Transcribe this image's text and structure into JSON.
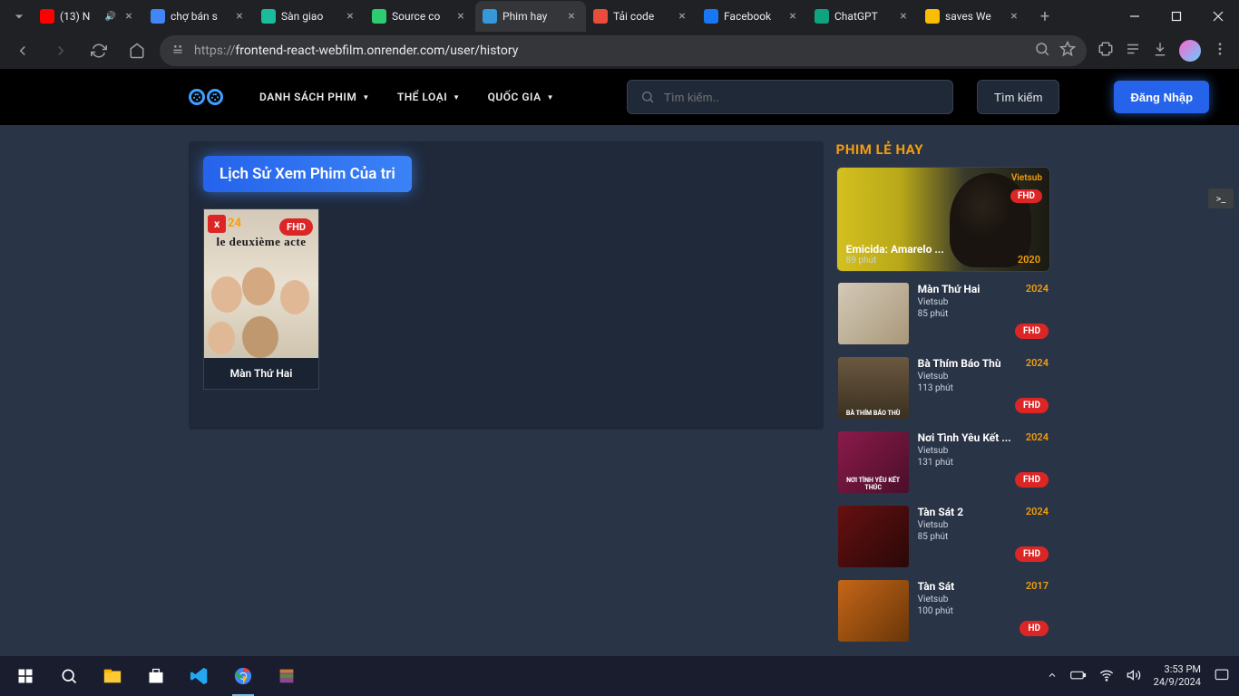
{
  "browser": {
    "tabs": [
      {
        "icon_bg": "#ff0000",
        "title": "(13) N",
        "audio": true
      },
      {
        "icon_bg": "#4285f4",
        "title": "chợ bán s"
      },
      {
        "icon_bg": "#1abc9c",
        "title": "Sàn giao"
      },
      {
        "icon_bg": "#2ecc71",
        "title": "Source co"
      },
      {
        "icon_bg": "#3498db",
        "title": "Phim hay",
        "active": true
      },
      {
        "icon_bg": "#e74c3c",
        "title": "Tải code"
      },
      {
        "icon_bg": "#1877f2",
        "title": "Facebook"
      },
      {
        "icon_bg": "#10a37f",
        "title": "ChatGPT"
      },
      {
        "icon_bg": "#fbbc04",
        "title": "saves We"
      }
    ],
    "url_scheme": "https://",
    "url_rest": "frontend-react-webfilm.onrender.com/user/history"
  },
  "nav": {
    "items": [
      "DANH SÁCH PHIM",
      "THỂ LOẠI",
      "QUỐC GIA"
    ],
    "search_placeholder": "Tìm kiếm..",
    "search_btn": "Tìm kiếm",
    "login_btn": "Đăng Nhập"
  },
  "main": {
    "history_title": "Lịch Sử Xem Phim Của tri",
    "card": {
      "remove": "x",
      "year": "24",
      "quality": "FHD",
      "poster_title": "le deuxième acte",
      "name": "Màn Thứ Hai"
    }
  },
  "sidebar": {
    "title": "PHIM LẺ HAY",
    "featured": {
      "sub": "Vietsub",
      "quality": "FHD",
      "title": "Emicida: Amarelo ...",
      "duration": "89 phút",
      "year": "2020"
    },
    "items": [
      {
        "title": "Màn Thứ Hai",
        "year": "2024",
        "sub": "Vietsub",
        "dur": "85 phút",
        "quality": "FHD",
        "thumb": "thumb-collage",
        "thumb_label": ""
      },
      {
        "title": "Bà Thím Báo Thù",
        "year": "2024",
        "sub": "Vietsub",
        "dur": "113 phút",
        "quality": "FHD",
        "thumb": "thumb-group",
        "thumb_label": "BÀ THÍM BÁO THÙ"
      },
      {
        "title": "Nơi Tình Yêu Kết ...",
        "year": "2024",
        "sub": "Vietsub",
        "dur": "131 phút",
        "quality": "FHD",
        "thumb": "thumb-pink",
        "thumb_label": "NƠI TÌNH YÊU KẾT THÚC"
      },
      {
        "title": "Tàn Sát 2",
        "year": "2024",
        "sub": "Vietsub",
        "dur": "85 phút",
        "quality": "FHD",
        "thumb": "thumb-red",
        "thumb_label": ""
      },
      {
        "title": "Tàn Sát",
        "year": "2017",
        "sub": "Vietsub",
        "dur": "100 phút",
        "quality": "HD",
        "thumb": "thumb-orange",
        "thumb_label": ""
      }
    ]
  },
  "taskbar": {
    "time": "3:53 PM",
    "date": "24/9/2024"
  }
}
